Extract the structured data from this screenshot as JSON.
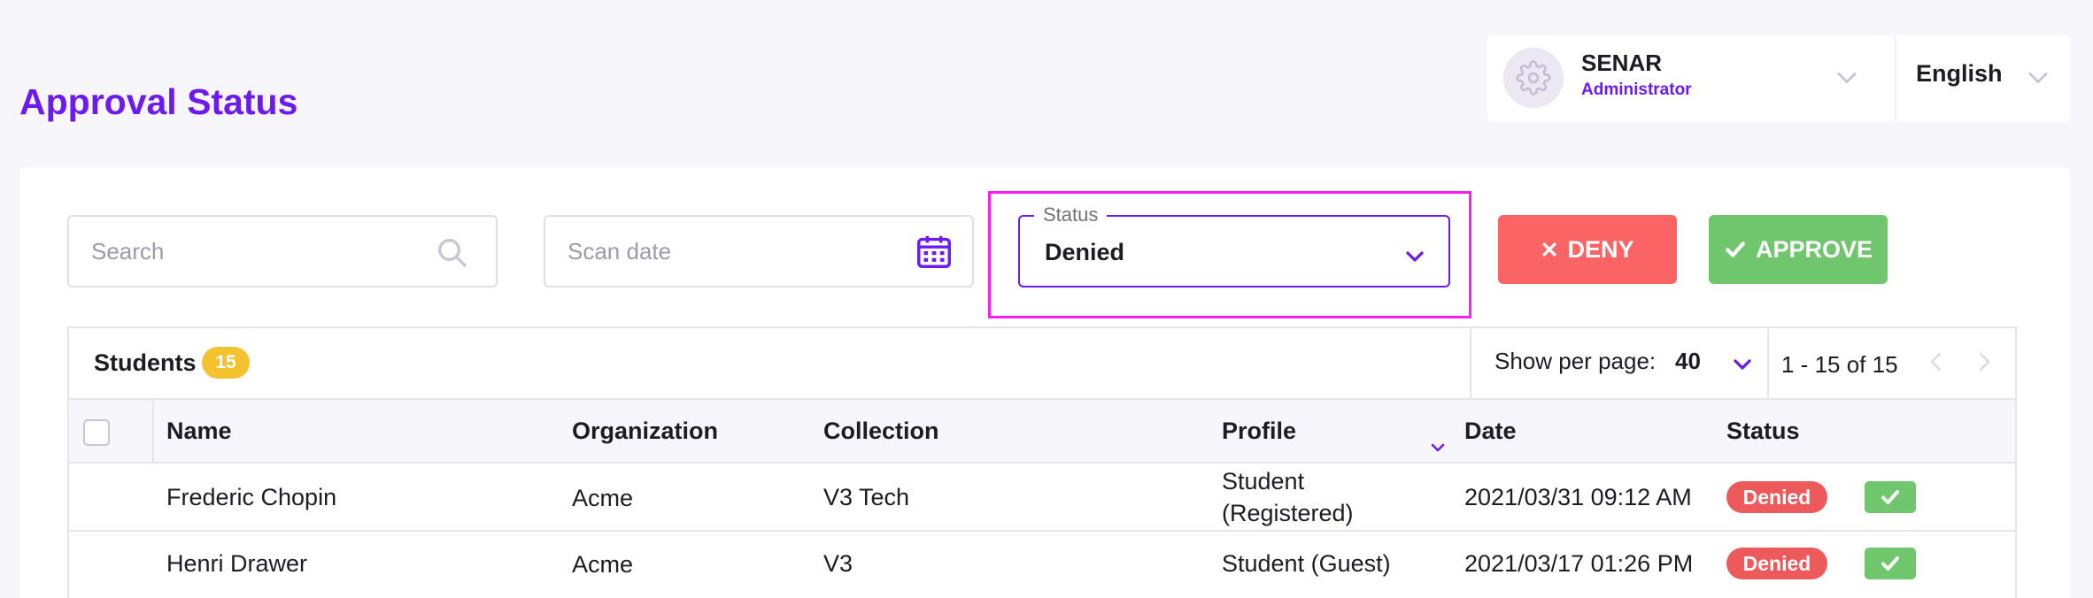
{
  "page": {
    "title": "Approval Status"
  },
  "user": {
    "name": "SENAR",
    "role": "Administrator",
    "avatar_icon": "gear-icon",
    "language": "English"
  },
  "filters": {
    "search_placeholder": "Search",
    "scan_date_placeholder": "Scan date",
    "status_label": "Status",
    "status_value": "Denied"
  },
  "actions": {
    "deny_label": "DENY",
    "approve_label": "APPROVE"
  },
  "table": {
    "title": "Students",
    "count": "15",
    "per_page_label": "Show per page:",
    "per_page_value": "40",
    "range": "1 - 15 of 15",
    "columns": [
      "Name",
      "Organization",
      "Collection",
      "Profile",
      "Date",
      "Status"
    ],
    "rows": [
      {
        "name": "Frederic Chopin",
        "organization": "Acme",
        "collection": "V3 Tech",
        "profile_line1": "Student",
        "profile_line2": "(Registered)",
        "date": "2021/03/31 09:12 AM",
        "status": "Denied"
      },
      {
        "name": "Henri Drawer",
        "organization": "Acme",
        "collection": "V3",
        "profile_line1": "Student (Guest)",
        "profile_line2": "",
        "date": "2021/03/17 01:26 PM",
        "status": "Denied"
      }
    ]
  },
  "colors": {
    "accent": "#6d1aee",
    "deny": "#fb6464",
    "approve": "#6fc66c",
    "denied_badge": "#ec5a5c",
    "count_badge": "#f4c22e",
    "highlight": "#ff1cf0"
  }
}
